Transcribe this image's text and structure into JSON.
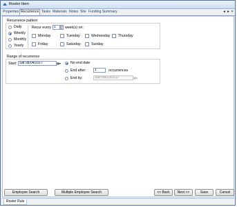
{
  "window": {
    "title": "Roster Item"
  },
  "tabs": [
    {
      "label": "Properties"
    },
    {
      "label": "Recurrence"
    },
    {
      "label": "Tasks"
    },
    {
      "label": "Materials"
    },
    {
      "label": "Notes"
    },
    {
      "label": "Site"
    },
    {
      "label": "Funding Summary"
    }
  ],
  "tab_controls": {
    "prev": "◄",
    "next": "►",
    "close": "✕"
  },
  "recurrence_pattern": {
    "title": "Recurrence pattern",
    "options": [
      {
        "label": "Daily",
        "selected": false
      },
      {
        "label": "Weekly",
        "selected": true
      },
      {
        "label": "Monthly",
        "selected": false
      },
      {
        "label": "Yearly",
        "selected": false
      }
    ],
    "recur_every_label": "Recur every",
    "recur_every_value": "1",
    "weeks_on_label": "week(s) on:",
    "days": [
      "Monday",
      "Tuesday",
      "Wednesday",
      "Thursday",
      "Friday",
      "Saturday",
      "Sunday"
    ]
  },
  "range": {
    "title": "Range of recurrence",
    "start_label": "Start:",
    "start_value": "Sat 08/04/2017",
    "options": [
      {
        "label": "No end date",
        "selected": true
      },
      {
        "label": "End after:",
        "selected": false
      },
      {
        "label": "End by:",
        "selected": false
      }
    ],
    "end_after_value": "1",
    "occurrences_label": "occurrences",
    "end_by_value": "Sun 08/10/2017"
  },
  "buttons": {
    "employee_search": "Employee Search",
    "multiple_employee_search": "Multiple Employee Search",
    "back": "<< Back",
    "next": "Next >>",
    "save": "Save",
    "cancel": "Cancel"
  },
  "bottom_tab": "Roster Rule"
}
